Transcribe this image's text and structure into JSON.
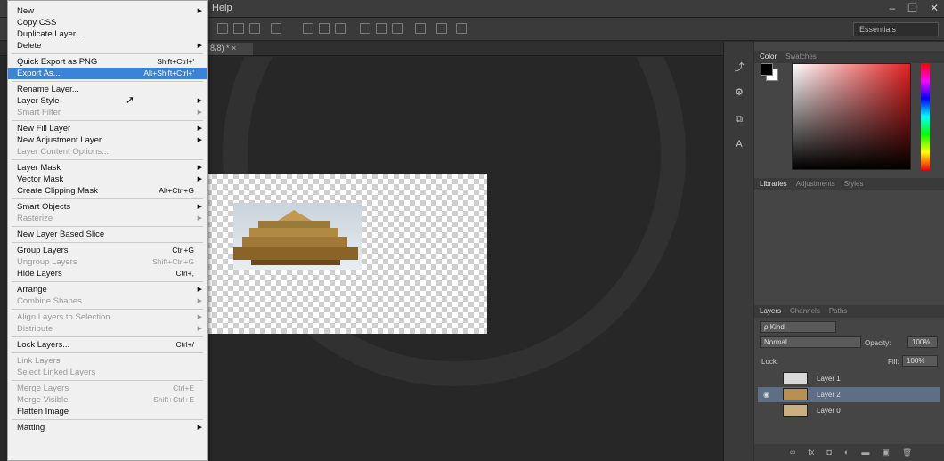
{
  "menubar": {
    "help": "Help",
    "minimize": "–",
    "restore": "❐",
    "close": "✕"
  },
  "options": {
    "workspace": "Essentials"
  },
  "document_tab": {
    "label": "8/8) * ×"
  },
  "context_menu": {
    "items": [
      {
        "label": "New",
        "shortcut": "",
        "submenu": true,
        "disabled": false
      },
      {
        "label": "Copy CSS",
        "shortcut": "",
        "submenu": false,
        "disabled": false
      },
      {
        "label": "Duplicate Layer...",
        "shortcut": "",
        "submenu": false,
        "disabled": false
      },
      {
        "label": "Delete",
        "shortcut": "",
        "submenu": true,
        "disabled": false
      },
      {
        "label": "Quick Export as PNG",
        "shortcut": "Shift+Ctrl+'",
        "submenu": false,
        "disabled": false
      },
      {
        "label": "Export As...",
        "shortcut": "Alt+Shift+Ctrl+'",
        "submenu": false,
        "disabled": false,
        "highlighted": true
      },
      {
        "label": "Rename Layer...",
        "shortcut": "",
        "submenu": false,
        "disabled": false
      },
      {
        "label": "Layer Style",
        "shortcut": "",
        "submenu": true,
        "disabled": false
      },
      {
        "label": "Smart Filter",
        "shortcut": "",
        "submenu": true,
        "disabled": true
      },
      {
        "label": "New Fill Layer",
        "shortcut": "",
        "submenu": true,
        "disabled": false
      },
      {
        "label": "New Adjustment Layer",
        "shortcut": "",
        "submenu": true,
        "disabled": false
      },
      {
        "label": "Layer Content Options...",
        "shortcut": "",
        "submenu": false,
        "disabled": true
      },
      {
        "label": "Layer Mask",
        "shortcut": "",
        "submenu": true,
        "disabled": false
      },
      {
        "label": "Vector Mask",
        "shortcut": "",
        "submenu": true,
        "disabled": false
      },
      {
        "label": "Create Clipping Mask",
        "shortcut": "Alt+Ctrl+G",
        "submenu": false,
        "disabled": false
      },
      {
        "label": "Smart Objects",
        "shortcut": "",
        "submenu": true,
        "disabled": false
      },
      {
        "label": "Rasterize",
        "shortcut": "",
        "submenu": true,
        "disabled": true
      },
      {
        "label": "New Layer Based Slice",
        "shortcut": "",
        "submenu": false,
        "disabled": false
      },
      {
        "label": "Group Layers",
        "shortcut": "Ctrl+G",
        "submenu": false,
        "disabled": false
      },
      {
        "label": "Ungroup Layers",
        "shortcut": "Shift+Ctrl+G",
        "submenu": false,
        "disabled": true
      },
      {
        "label": "Hide Layers",
        "shortcut": "Ctrl+,",
        "submenu": false,
        "disabled": false
      },
      {
        "label": "Arrange",
        "shortcut": "",
        "submenu": true,
        "disabled": false
      },
      {
        "label": "Combine Shapes",
        "shortcut": "",
        "submenu": true,
        "disabled": true
      },
      {
        "label": "Align Layers to Selection",
        "shortcut": "",
        "submenu": true,
        "disabled": true
      },
      {
        "label": "Distribute",
        "shortcut": "",
        "submenu": true,
        "disabled": true
      },
      {
        "label": "Lock Layers...",
        "shortcut": "Ctrl+/",
        "submenu": false,
        "disabled": false
      },
      {
        "label": "Link Layers",
        "shortcut": "",
        "submenu": false,
        "disabled": true
      },
      {
        "label": "Select Linked Layers",
        "shortcut": "",
        "submenu": false,
        "disabled": true
      },
      {
        "label": "Merge Layers",
        "shortcut": "Ctrl+E",
        "submenu": false,
        "disabled": true
      },
      {
        "label": "Merge Visible",
        "shortcut": "Shift+Ctrl+E",
        "submenu": false,
        "disabled": true
      },
      {
        "label": "Flatten Image",
        "shortcut": "",
        "submenu": false,
        "disabled": false
      },
      {
        "label": "Matting",
        "shortcut": "",
        "submenu": true,
        "disabled": false
      }
    ]
  },
  "color_panel": {
    "tabs": [
      "Color",
      "Swatches"
    ],
    "foreground": "#000000",
    "background": "#ffffff"
  },
  "libraries_panel": {
    "tabs": [
      "Libraries",
      "Adjustments",
      "Styles"
    ]
  },
  "layers_panel": {
    "tabs": [
      "Layers",
      "Channels",
      "Paths"
    ],
    "kind": "ρ Kind",
    "blend_mode": "Normal",
    "opacity_label": "Opacity:",
    "opacity": "100%",
    "lock_label": "Lock:",
    "fill_label": "Fill:",
    "fill": "100%",
    "layers": [
      {
        "name": "Layer 1",
        "visible": false,
        "selected": false
      },
      {
        "name": "Layer 2",
        "visible": true,
        "selected": true
      },
      {
        "name": "Layer 0",
        "visible": false,
        "selected": false
      }
    ]
  }
}
